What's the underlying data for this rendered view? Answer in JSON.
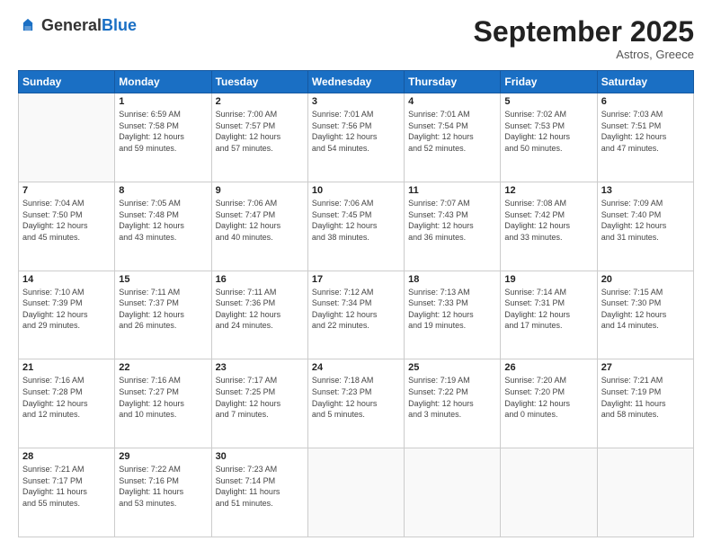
{
  "logo": {
    "general": "General",
    "blue": "Blue"
  },
  "header": {
    "month": "September 2025",
    "location": "Astros, Greece"
  },
  "days_of_week": [
    "Sunday",
    "Monday",
    "Tuesday",
    "Wednesday",
    "Thursday",
    "Friday",
    "Saturday"
  ],
  "weeks": [
    [
      {
        "day": "",
        "info": ""
      },
      {
        "day": "1",
        "info": "Sunrise: 6:59 AM\nSunset: 7:58 PM\nDaylight: 12 hours\nand 59 minutes."
      },
      {
        "day": "2",
        "info": "Sunrise: 7:00 AM\nSunset: 7:57 PM\nDaylight: 12 hours\nand 57 minutes."
      },
      {
        "day": "3",
        "info": "Sunrise: 7:01 AM\nSunset: 7:56 PM\nDaylight: 12 hours\nand 54 minutes."
      },
      {
        "day": "4",
        "info": "Sunrise: 7:01 AM\nSunset: 7:54 PM\nDaylight: 12 hours\nand 52 minutes."
      },
      {
        "day": "5",
        "info": "Sunrise: 7:02 AM\nSunset: 7:53 PM\nDaylight: 12 hours\nand 50 minutes."
      },
      {
        "day": "6",
        "info": "Sunrise: 7:03 AM\nSunset: 7:51 PM\nDaylight: 12 hours\nand 47 minutes."
      }
    ],
    [
      {
        "day": "7",
        "info": "Sunrise: 7:04 AM\nSunset: 7:50 PM\nDaylight: 12 hours\nand 45 minutes."
      },
      {
        "day": "8",
        "info": "Sunrise: 7:05 AM\nSunset: 7:48 PM\nDaylight: 12 hours\nand 43 minutes."
      },
      {
        "day": "9",
        "info": "Sunrise: 7:06 AM\nSunset: 7:47 PM\nDaylight: 12 hours\nand 40 minutes."
      },
      {
        "day": "10",
        "info": "Sunrise: 7:06 AM\nSunset: 7:45 PM\nDaylight: 12 hours\nand 38 minutes."
      },
      {
        "day": "11",
        "info": "Sunrise: 7:07 AM\nSunset: 7:43 PM\nDaylight: 12 hours\nand 36 minutes."
      },
      {
        "day": "12",
        "info": "Sunrise: 7:08 AM\nSunset: 7:42 PM\nDaylight: 12 hours\nand 33 minutes."
      },
      {
        "day": "13",
        "info": "Sunrise: 7:09 AM\nSunset: 7:40 PM\nDaylight: 12 hours\nand 31 minutes."
      }
    ],
    [
      {
        "day": "14",
        "info": "Sunrise: 7:10 AM\nSunset: 7:39 PM\nDaylight: 12 hours\nand 29 minutes."
      },
      {
        "day": "15",
        "info": "Sunrise: 7:11 AM\nSunset: 7:37 PM\nDaylight: 12 hours\nand 26 minutes."
      },
      {
        "day": "16",
        "info": "Sunrise: 7:11 AM\nSunset: 7:36 PM\nDaylight: 12 hours\nand 24 minutes."
      },
      {
        "day": "17",
        "info": "Sunrise: 7:12 AM\nSunset: 7:34 PM\nDaylight: 12 hours\nand 22 minutes."
      },
      {
        "day": "18",
        "info": "Sunrise: 7:13 AM\nSunset: 7:33 PM\nDaylight: 12 hours\nand 19 minutes."
      },
      {
        "day": "19",
        "info": "Sunrise: 7:14 AM\nSunset: 7:31 PM\nDaylight: 12 hours\nand 17 minutes."
      },
      {
        "day": "20",
        "info": "Sunrise: 7:15 AM\nSunset: 7:30 PM\nDaylight: 12 hours\nand 14 minutes."
      }
    ],
    [
      {
        "day": "21",
        "info": "Sunrise: 7:16 AM\nSunset: 7:28 PM\nDaylight: 12 hours\nand 12 minutes."
      },
      {
        "day": "22",
        "info": "Sunrise: 7:16 AM\nSunset: 7:27 PM\nDaylight: 12 hours\nand 10 minutes."
      },
      {
        "day": "23",
        "info": "Sunrise: 7:17 AM\nSunset: 7:25 PM\nDaylight: 12 hours\nand 7 minutes."
      },
      {
        "day": "24",
        "info": "Sunrise: 7:18 AM\nSunset: 7:23 PM\nDaylight: 12 hours\nand 5 minutes."
      },
      {
        "day": "25",
        "info": "Sunrise: 7:19 AM\nSunset: 7:22 PM\nDaylight: 12 hours\nand 3 minutes."
      },
      {
        "day": "26",
        "info": "Sunrise: 7:20 AM\nSunset: 7:20 PM\nDaylight: 12 hours\nand 0 minutes."
      },
      {
        "day": "27",
        "info": "Sunrise: 7:21 AM\nSunset: 7:19 PM\nDaylight: 11 hours\nand 58 minutes."
      }
    ],
    [
      {
        "day": "28",
        "info": "Sunrise: 7:21 AM\nSunset: 7:17 PM\nDaylight: 11 hours\nand 55 minutes."
      },
      {
        "day": "29",
        "info": "Sunrise: 7:22 AM\nSunset: 7:16 PM\nDaylight: 11 hours\nand 53 minutes."
      },
      {
        "day": "30",
        "info": "Sunrise: 7:23 AM\nSunset: 7:14 PM\nDaylight: 11 hours\nand 51 minutes."
      },
      {
        "day": "",
        "info": ""
      },
      {
        "day": "",
        "info": ""
      },
      {
        "day": "",
        "info": ""
      },
      {
        "day": "",
        "info": ""
      }
    ]
  ]
}
